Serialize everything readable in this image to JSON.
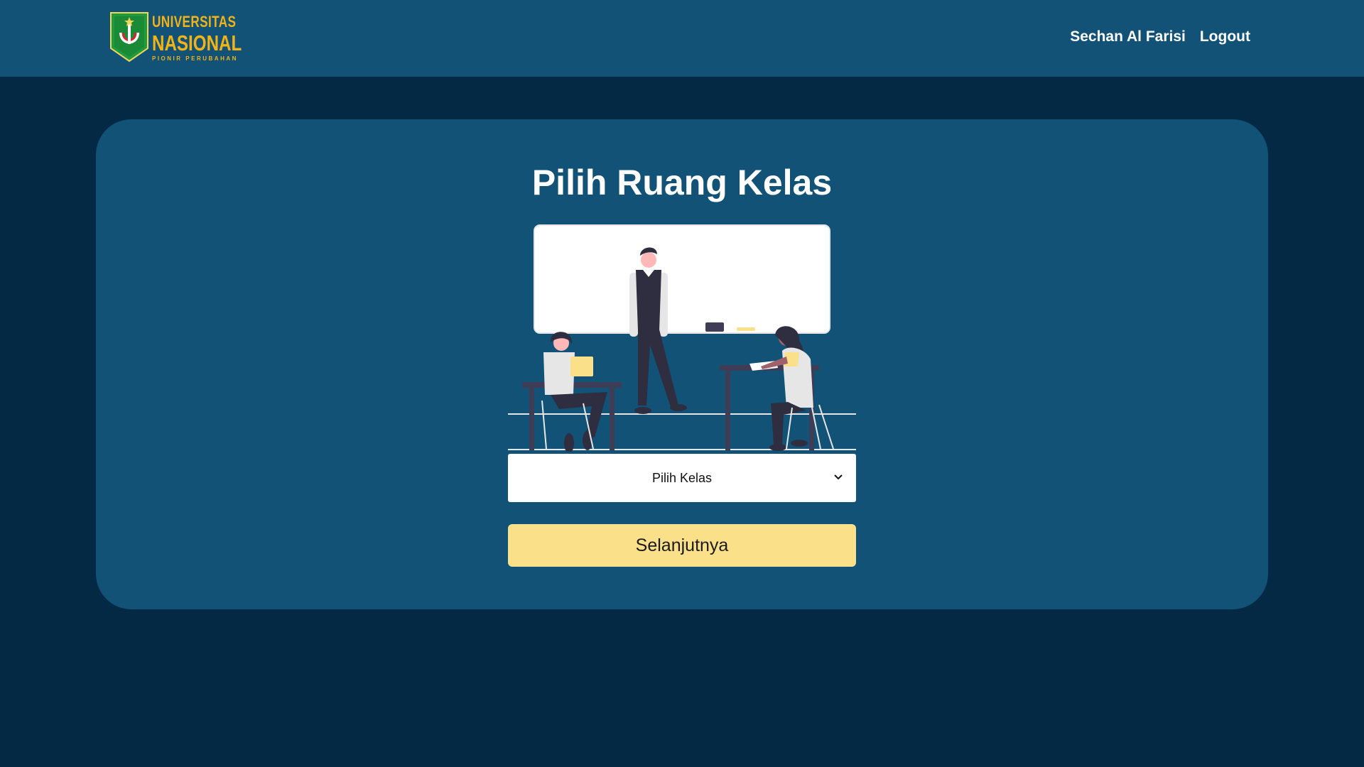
{
  "header": {
    "logo": {
      "line1": "UNIVERSITAS",
      "line2": "NASIONAL",
      "line3": "PIONIR PERUBAHAN",
      "icon": "university-crest-logo"
    },
    "user_name": "Sechan Al Farisi",
    "logout_label": "Logout"
  },
  "main": {
    "title": "Pilih Ruang Kelas",
    "illustration_icon": "classroom-illustration",
    "select": {
      "selected": "Pilih Kelas",
      "icon": "chevron-down-icon"
    },
    "next_button": "Selanjutnya"
  },
  "colors": {
    "page_background": "#032944",
    "navbar": "#125277",
    "card": "#125277",
    "logo_text": "#f2b317",
    "button": "#fbe08a"
  }
}
